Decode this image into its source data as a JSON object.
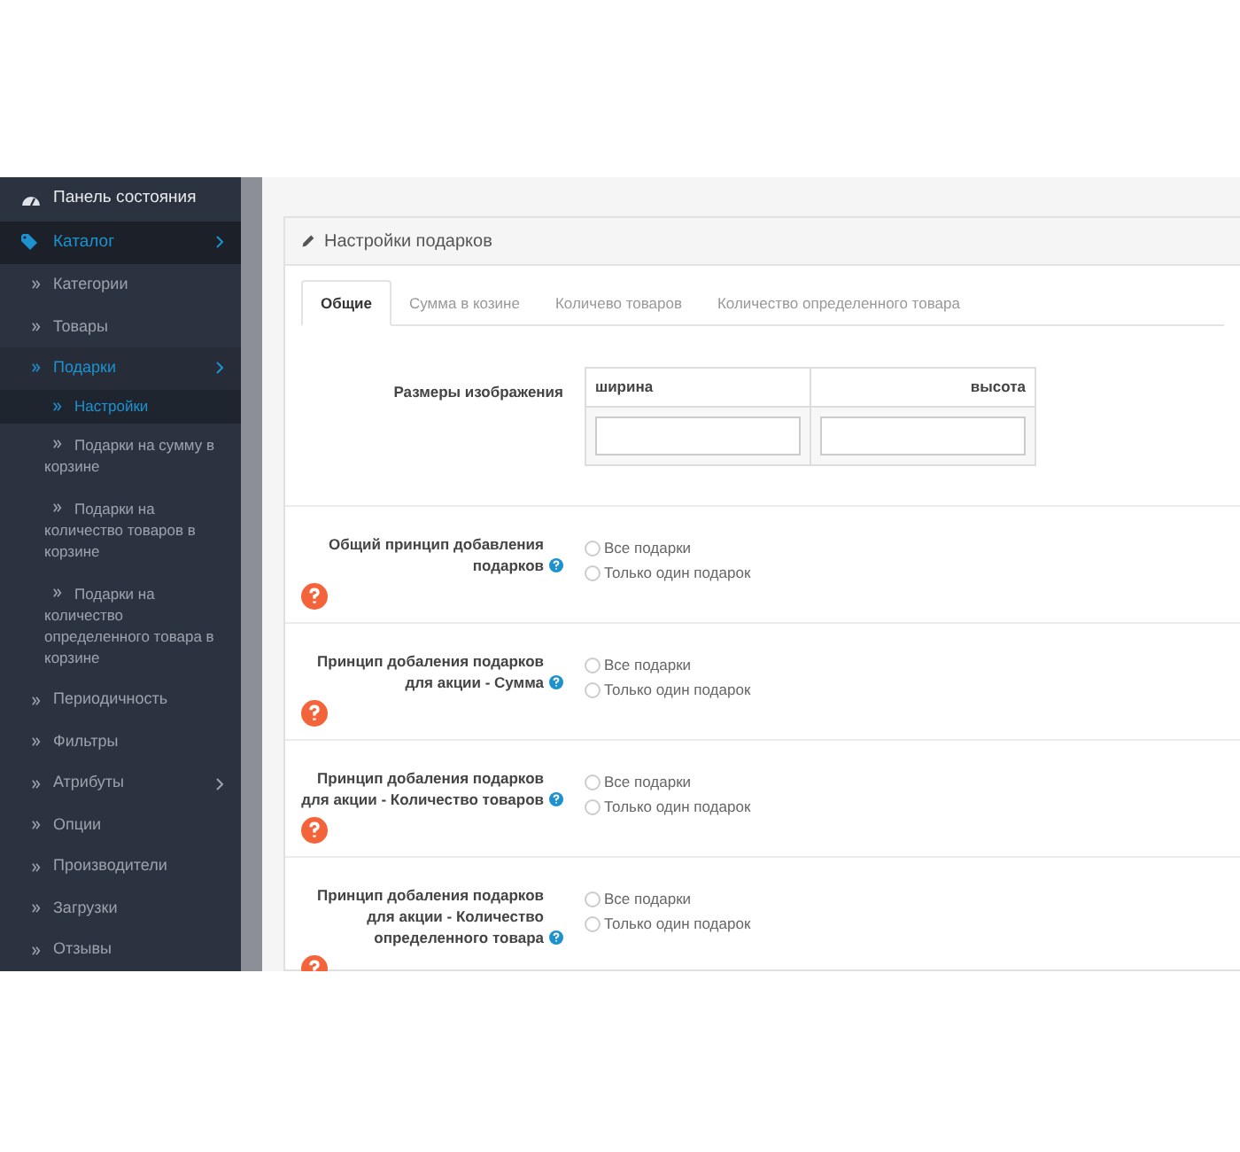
{
  "sidebar": {
    "items": [
      {
        "label": "Панель состояния",
        "kind": "top",
        "selected": false,
        "has_submenu": false
      },
      {
        "label": "Каталог",
        "kind": "top",
        "selected": true,
        "has_submenu": true
      },
      {
        "label": "Категории",
        "kind": "sub",
        "selected": false,
        "has_submenu": false
      },
      {
        "label": "Товары",
        "kind": "sub",
        "selected": false,
        "has_submenu": false
      },
      {
        "label": "Подарки",
        "kind": "sub",
        "selected": true,
        "has_submenu": true,
        "children": [
          {
            "label": "Настройки",
            "selected": true
          },
          {
            "label": "Подарки на сумму в корзине",
            "selected": false
          },
          {
            "label": "Подарки на количество товаров в корзине",
            "selected": false
          },
          {
            "label": "Подарки на количество определенного товара в корзине",
            "selected": false
          }
        ]
      },
      {
        "label": "Периодичность",
        "kind": "sub",
        "selected": false,
        "has_submenu": false
      },
      {
        "label": "Фильтры",
        "kind": "sub",
        "selected": false,
        "has_submenu": false
      },
      {
        "label": "Атрибуты",
        "kind": "sub",
        "selected": false,
        "has_submenu": true
      },
      {
        "label": "Опции",
        "kind": "sub",
        "selected": false,
        "has_submenu": false
      },
      {
        "label": "Производители",
        "kind": "sub",
        "selected": false,
        "has_submenu": false
      },
      {
        "label": "Загрузки",
        "kind": "sub",
        "selected": false,
        "has_submenu": false
      },
      {
        "label": "Отзывы",
        "kind": "sub",
        "selected": false,
        "has_submenu": false
      }
    ]
  },
  "panel": {
    "title": "Настройки подарков",
    "tabs": [
      {
        "label": "Общие",
        "selected": true
      },
      {
        "label": "Сумма в козине",
        "selected": false
      },
      {
        "label": "Количево товаров",
        "selected": false
      },
      {
        "label": "Количество определенного товара",
        "selected": false
      }
    ],
    "image_size": {
      "label": "Размеры изображения",
      "columns": [
        "ширина",
        "высота"
      ]
    },
    "settings": [
      {
        "label": "Общий принцип добавления подарков",
        "options": [
          {
            "label": "Все подарки",
            "selected": false
          },
          {
            "label": "Только один подарок",
            "selected": false
          }
        ]
      },
      {
        "label": "Принцип добаления подарков для акции - Сумма",
        "options": [
          {
            "label": "Все подарки",
            "selected": false
          },
          {
            "label": "Только один подарок",
            "selected": false
          }
        ]
      },
      {
        "label": "Принцип добаления подарков для акции - Количество товаров",
        "options": [
          {
            "label": "Все подарки",
            "selected": false
          },
          {
            "label": "Только один подарок",
            "selected": false
          }
        ]
      },
      {
        "label": "Принцип добаления подарков для акции - Количество определенного товара",
        "options": [
          {
            "label": "Все подарки",
            "selected": false
          },
          {
            "label": "Только один подарок",
            "selected": false
          }
        ]
      }
    ]
  }
}
